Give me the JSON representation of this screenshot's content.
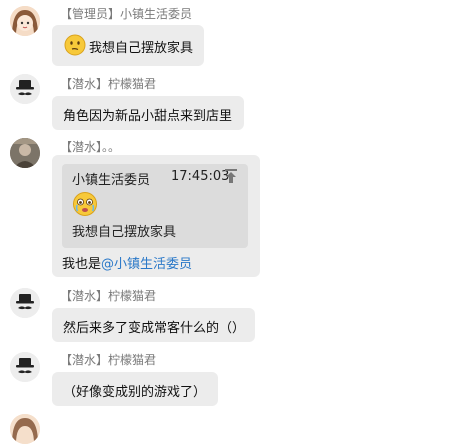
{
  "messages": [
    {
      "role": "【管理员】",
      "name": "小镇生活委员",
      "avatar_icon": "girl-avatar",
      "emoji_icon": "curious-face-emoji",
      "text": "我想自己摆放家具"
    },
    {
      "role": "【潜水】",
      "name": "柠檬猫君",
      "avatar_icon": "hat-mustache-avatar",
      "text": "角色因为新品小甜点来到店里"
    },
    {
      "role": "【潜水】",
      "name": "。。",
      "avatar_icon": "photo-avatar",
      "quote": {
        "name": "小镇生活委员",
        "time": "17:45:03",
        "emoji_icon": "crying-face-emoji",
        "text": "我想自己摆放家具"
      },
      "reply_prefix": "我也是",
      "mention": "@小镇生活委员"
    },
    {
      "role": "【潜水】",
      "name": "柠檬猫君",
      "avatar_icon": "hat-mustache-avatar",
      "text": "然后来多了变成常客什么的（）"
    },
    {
      "role": "【潜水】",
      "name": "柠檬猫君",
      "avatar_icon": "hat-mustache-avatar",
      "text": "（好像变成别的游戏了）"
    }
  ],
  "colors": {
    "bubble": "#ececec",
    "quote_bg": "#dcdcdc",
    "mention": "#2a78c8",
    "sender": "#7a7a7a"
  }
}
